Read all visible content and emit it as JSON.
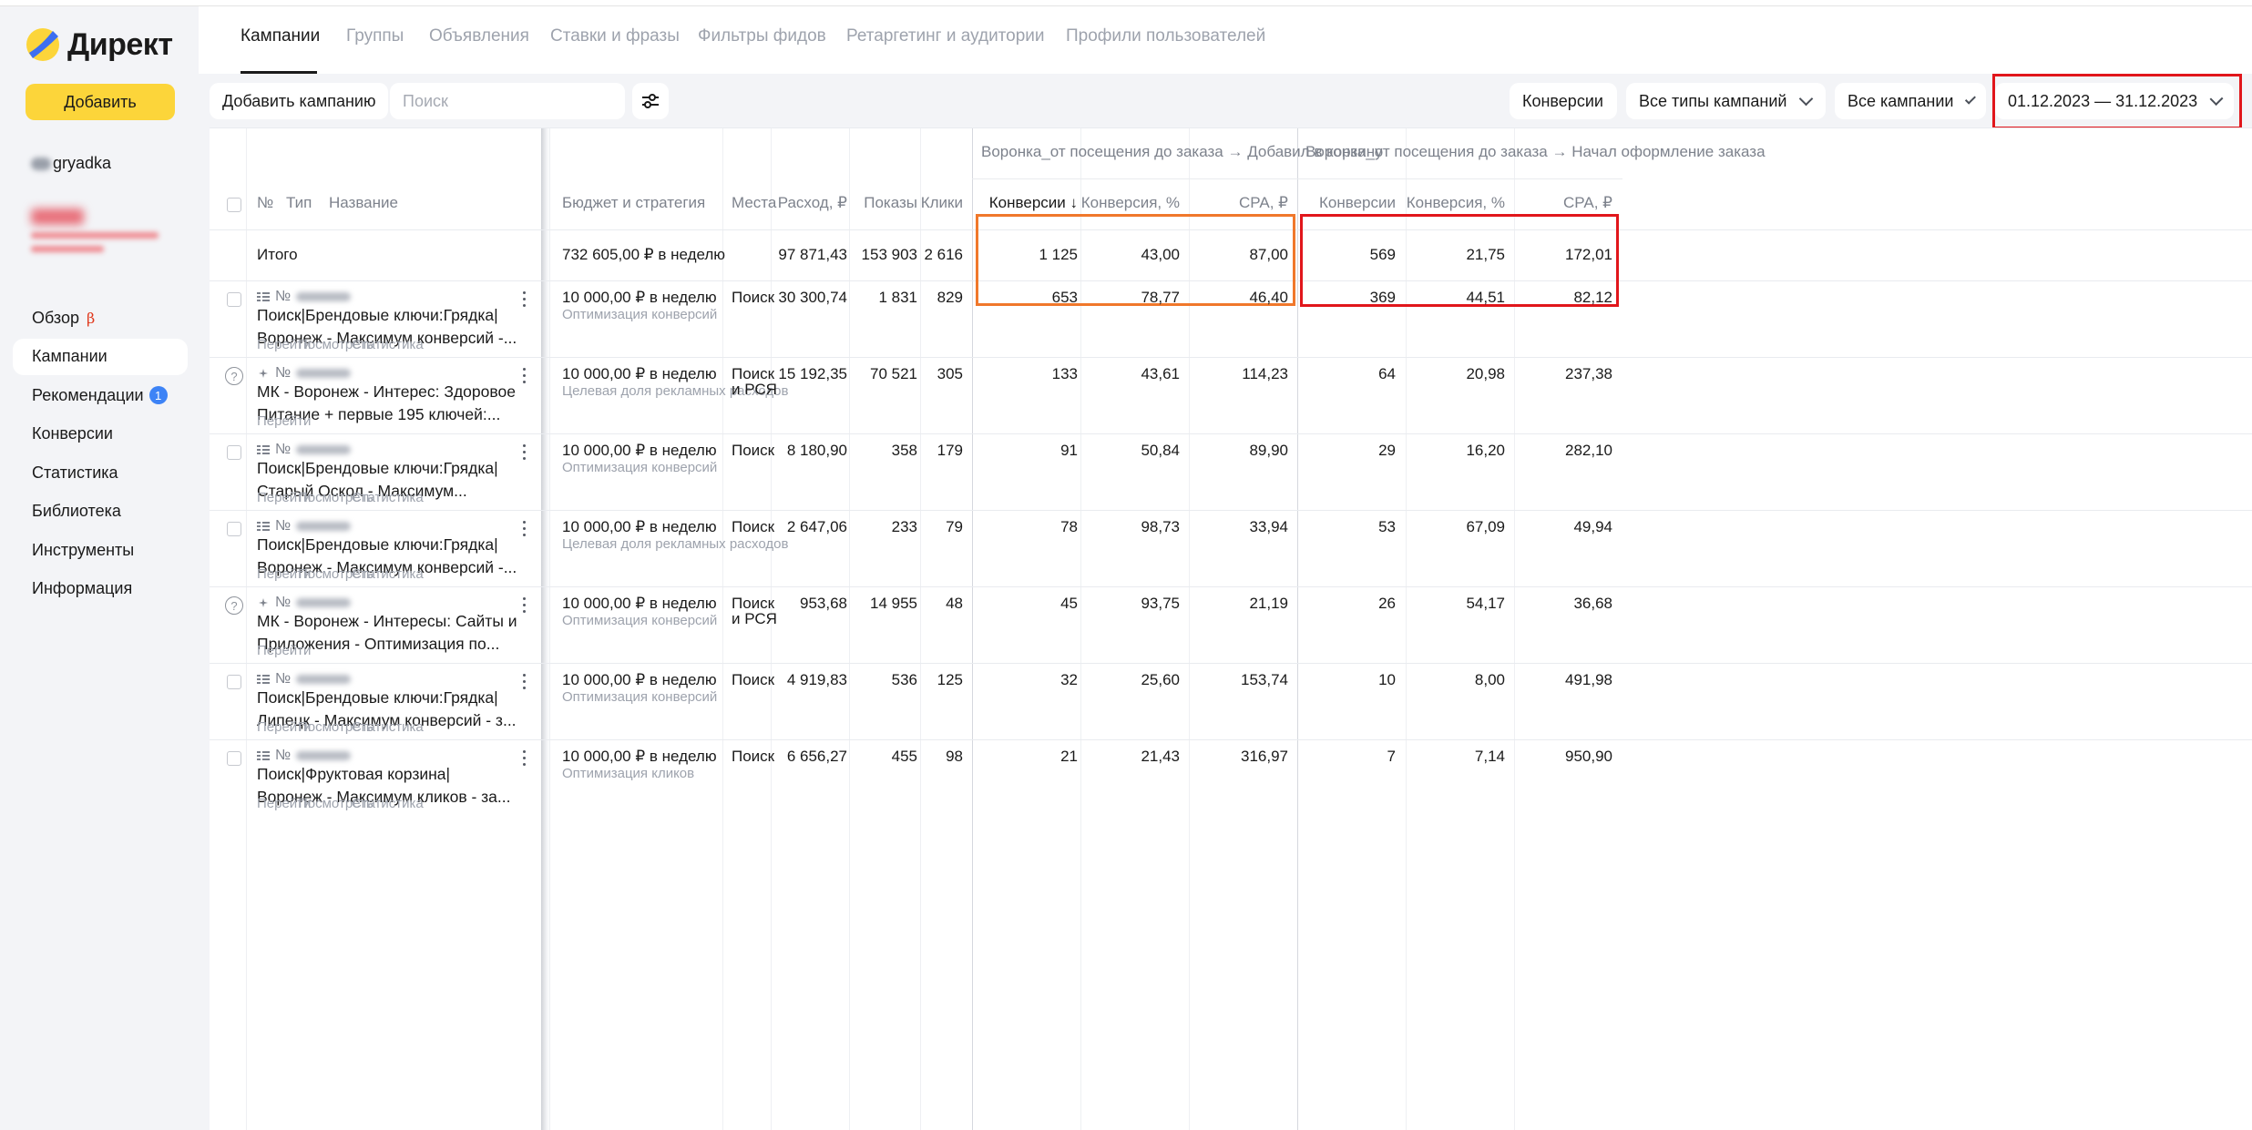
{
  "app": {
    "logo_text": "Директ",
    "add_label": "Добавить",
    "login": "gryadka"
  },
  "sidebar": {
    "items": [
      {
        "label": "Обзор",
        "beta": "β"
      },
      {
        "label": "Кампании",
        "active": true
      },
      {
        "label": "Рекомендации",
        "badge": "1"
      },
      {
        "label": "Конверсии"
      },
      {
        "label": "Статистика"
      },
      {
        "label": "Библиотека"
      },
      {
        "label": "Инструменты"
      },
      {
        "label": "Информация"
      }
    ]
  },
  "tabs": [
    "Кампании",
    "Группы",
    "Объявления",
    "Ставки и фразы",
    "Фильтры фидов",
    "Ретаргетинг и аудитории",
    "Профили пользователей"
  ],
  "toolbar": {
    "add_campaign": "Добавить кампанию",
    "search_placeholder": "Поиск",
    "conversions": "Конверсии",
    "campaign_types": "Все типы кампаний",
    "campaigns": "Все кампании",
    "date_range": "01.12.2023 — 31.12.2023"
  },
  "table": {
    "group1_title": "Воронка_от посещения до заказа → Добавил в корзину",
    "group2_title": "Воронка_от посещения до заказа → Начал оформление заказа",
    "headers": {
      "num": "№",
      "type": "Тип",
      "name": "Название",
      "budget": "Бюджет и стратегия",
      "places": "Места",
      "spend": "Расход, ₽",
      "shows": "Показы",
      "clicks": "Клики",
      "conv1": "Конверсии ↓",
      "convp1": "Конверсия, %",
      "cpa1": "CPA, ₽",
      "conv2": "Конверсии",
      "convp2": "Конверсия, %",
      "cpa2": "CPA, ₽"
    },
    "total": {
      "label": "Итого",
      "budget": "732 605,00 ₽ в неделю",
      "spend": "97 871,43",
      "shows": "153 903",
      "clicks": "2 616",
      "conv1": "1 125",
      "convp1": "43,00",
      "cpa1": "87,00",
      "conv2": "569",
      "convp2": "21,75",
      "cpa2": "172,01"
    },
    "rows": [
      {
        "type": "search",
        "name_line1": "Поиск|Брендовые ключи:Грядка|",
        "name_line2": "Воронеж - Максимум конверсий -...",
        "links": [
          "Перейти",
          "Посмотреть",
          "Статистика"
        ],
        "help": false,
        "budget": "10 000,00 ₽ в неделю",
        "strategy": "Оптимизация конверсий",
        "places": [
          "Поиск"
        ],
        "spend": "30 300,74",
        "shows": "1 831",
        "clicks": "829",
        "conv1": "653",
        "convp1": "78,77",
        "cpa1": "46,40",
        "conv2": "369",
        "convp2": "44,51",
        "cpa2": "82,12"
      },
      {
        "type": "mk",
        "name_line1": "МК - Воронеж - Интерес: Здоровое",
        "name_line2": "Питание + первые 195 ключей:...",
        "links": [
          "Перейти"
        ],
        "help": true,
        "budget": "10 000,00 ₽ в неделю",
        "strategy": "Целевая доля рекламных расходов",
        "places": [
          "Поиск",
          "и РСЯ"
        ],
        "spend": "15 192,35",
        "shows": "70 521",
        "clicks": "305",
        "conv1": "133",
        "convp1": "43,61",
        "cpa1": "114,23",
        "conv2": "64",
        "convp2": "20,98",
        "cpa2": "237,38"
      },
      {
        "type": "search",
        "name_line1": "Поиск|Брендовые ключи:Грядка|",
        "name_line2": "Старый Оскол - Максимум...",
        "links": [
          "Перейти",
          "Посмотреть",
          "Статистика"
        ],
        "help": false,
        "budget": "10 000,00 ₽ в неделю",
        "strategy": "Оптимизация конверсий",
        "places": [
          "Поиск"
        ],
        "spend": "8 180,90",
        "shows": "358",
        "clicks": "179",
        "conv1": "91",
        "convp1": "50,84",
        "cpa1": "89,90",
        "conv2": "29",
        "convp2": "16,20",
        "cpa2": "282,10"
      },
      {
        "type": "search",
        "name_line1": "Поиск|Брендовые ключи:Грядка|",
        "name_line2": "Воронеж - Максимум конверсий -...",
        "links": [
          "Перейти",
          "Посмотреть",
          "Статистика"
        ],
        "help": false,
        "budget": "10 000,00 ₽ в неделю",
        "strategy": "Целевая доля рекламных расходов",
        "places": [
          "Поиск"
        ],
        "spend": "2 647,06",
        "shows": "233",
        "clicks": "79",
        "conv1": "78",
        "convp1": "98,73",
        "cpa1": "33,94",
        "conv2": "53",
        "convp2": "67,09",
        "cpa2": "49,94"
      },
      {
        "type": "mk",
        "name_line1": "МК - Воронеж - Интересы: Сайты и",
        "name_line2": "Приложения - Оптимизация по...",
        "links": [
          "Перейти"
        ],
        "help": true,
        "budget": "10 000,00 ₽ в неделю",
        "strategy": "Оптимизация конверсий",
        "places": [
          "Поиск",
          "и РСЯ"
        ],
        "spend": "953,68",
        "shows": "14 955",
        "clicks": "48",
        "conv1": "45",
        "convp1": "93,75",
        "cpa1": "21,19",
        "conv2": "26",
        "convp2": "54,17",
        "cpa2": "36,68"
      },
      {
        "type": "search",
        "name_line1": "Поиск|Брендовые ключи:Грядка|",
        "name_line2": "Липецк - Максимум конверсий - з...",
        "links": [
          "Перейти",
          "Посмотреть",
          "Статистика"
        ],
        "help": false,
        "budget": "10 000,00 ₽ в неделю",
        "strategy": "Оптимизация конверсий",
        "places": [
          "Поиск"
        ],
        "spend": "4 919,83",
        "shows": "536",
        "clicks": "125",
        "conv1": "32",
        "convp1": "25,60",
        "cpa1": "153,74",
        "conv2": "10",
        "convp2": "8,00",
        "cpa2": "491,98"
      },
      {
        "type": "search",
        "name_line1": "Поиск|Фруктовая корзина|",
        "name_line2": "Воронеж - Максимум кликов - за...",
        "links": [
          "Перейти",
          "Посмотреть",
          "Статистика"
        ],
        "help": false,
        "budget": "10 000,00 ₽ в неделю",
        "strategy": "Оптимизация кликов",
        "places": [
          "Поиск"
        ],
        "spend": "6 656,27",
        "shows": "455",
        "clicks": "98",
        "conv1": "21",
        "convp1": "21,43",
        "cpa1": "316,97",
        "conv2": "7",
        "convp2": "7,14",
        "cpa2": "950,90"
      }
    ]
  },
  "colors": {
    "accent_yellow": "#fcd53a",
    "highlight_orange": "#f0782b",
    "highlight_red": "#e1161b",
    "badge_blue": "#3d83f6",
    "beta_red": "#e0371b"
  }
}
